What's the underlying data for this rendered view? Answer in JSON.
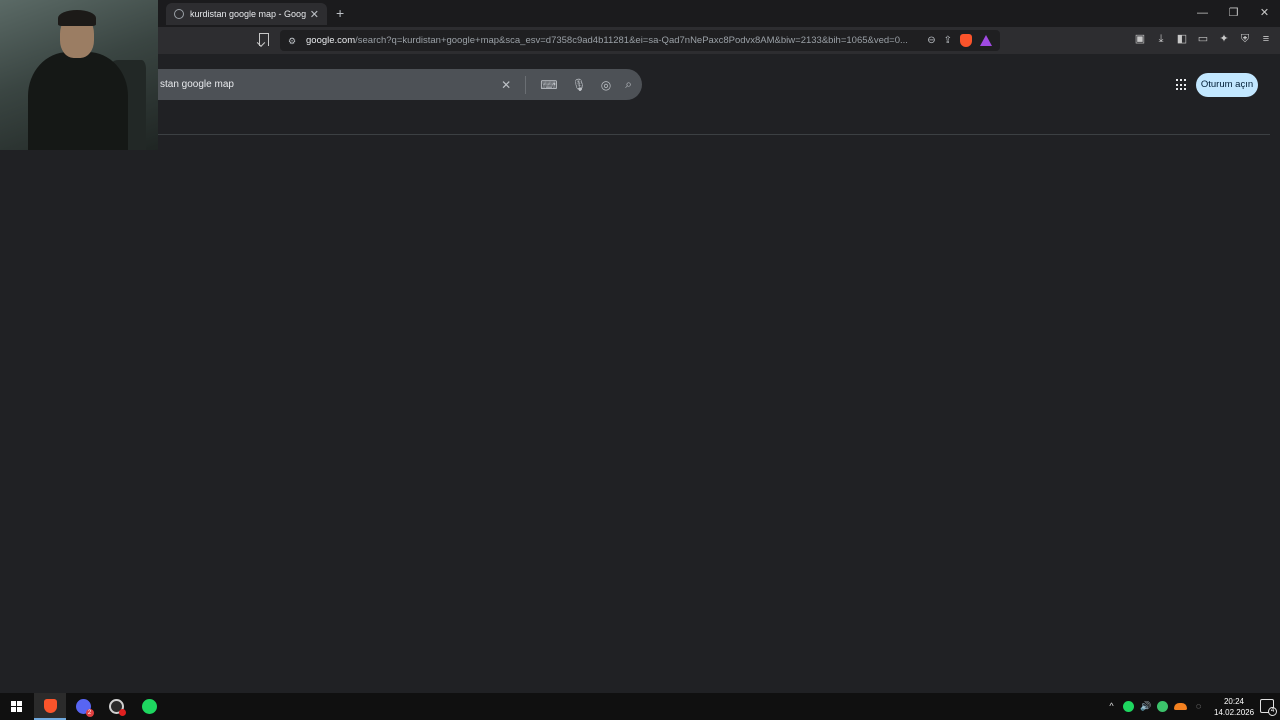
{
  "browser": {
    "tab_title": "kurdistan google map - Google",
    "tab_close": "✕",
    "new_tab": "+",
    "window_controls": {
      "minimize": "—",
      "restore": "❐",
      "close": "✕"
    },
    "url_host": "google.com",
    "url_path": "/search?q=kurdistan+google+map&sca_esv=d7358c9ad4b11281&ei=sa-Qad7nNePaxc8Podvx8AM&biw=2133&bih=1065&ved=0..."
  },
  "search": {
    "query": "stan google map"
  },
  "header": {
    "signin_label": "Oturum açın"
  },
  "taskbar": {
    "discord_badge": "2",
    "time": "20:24",
    "date": "14.02.2026",
    "notifications_count": "4"
  },
  "colors": {
    "page_bg": "#202124",
    "search_box": "#4d5156",
    "signin_bg": "#c2e7ff",
    "brave_orange": "#fb542b",
    "spotify_green": "#1ed760"
  }
}
